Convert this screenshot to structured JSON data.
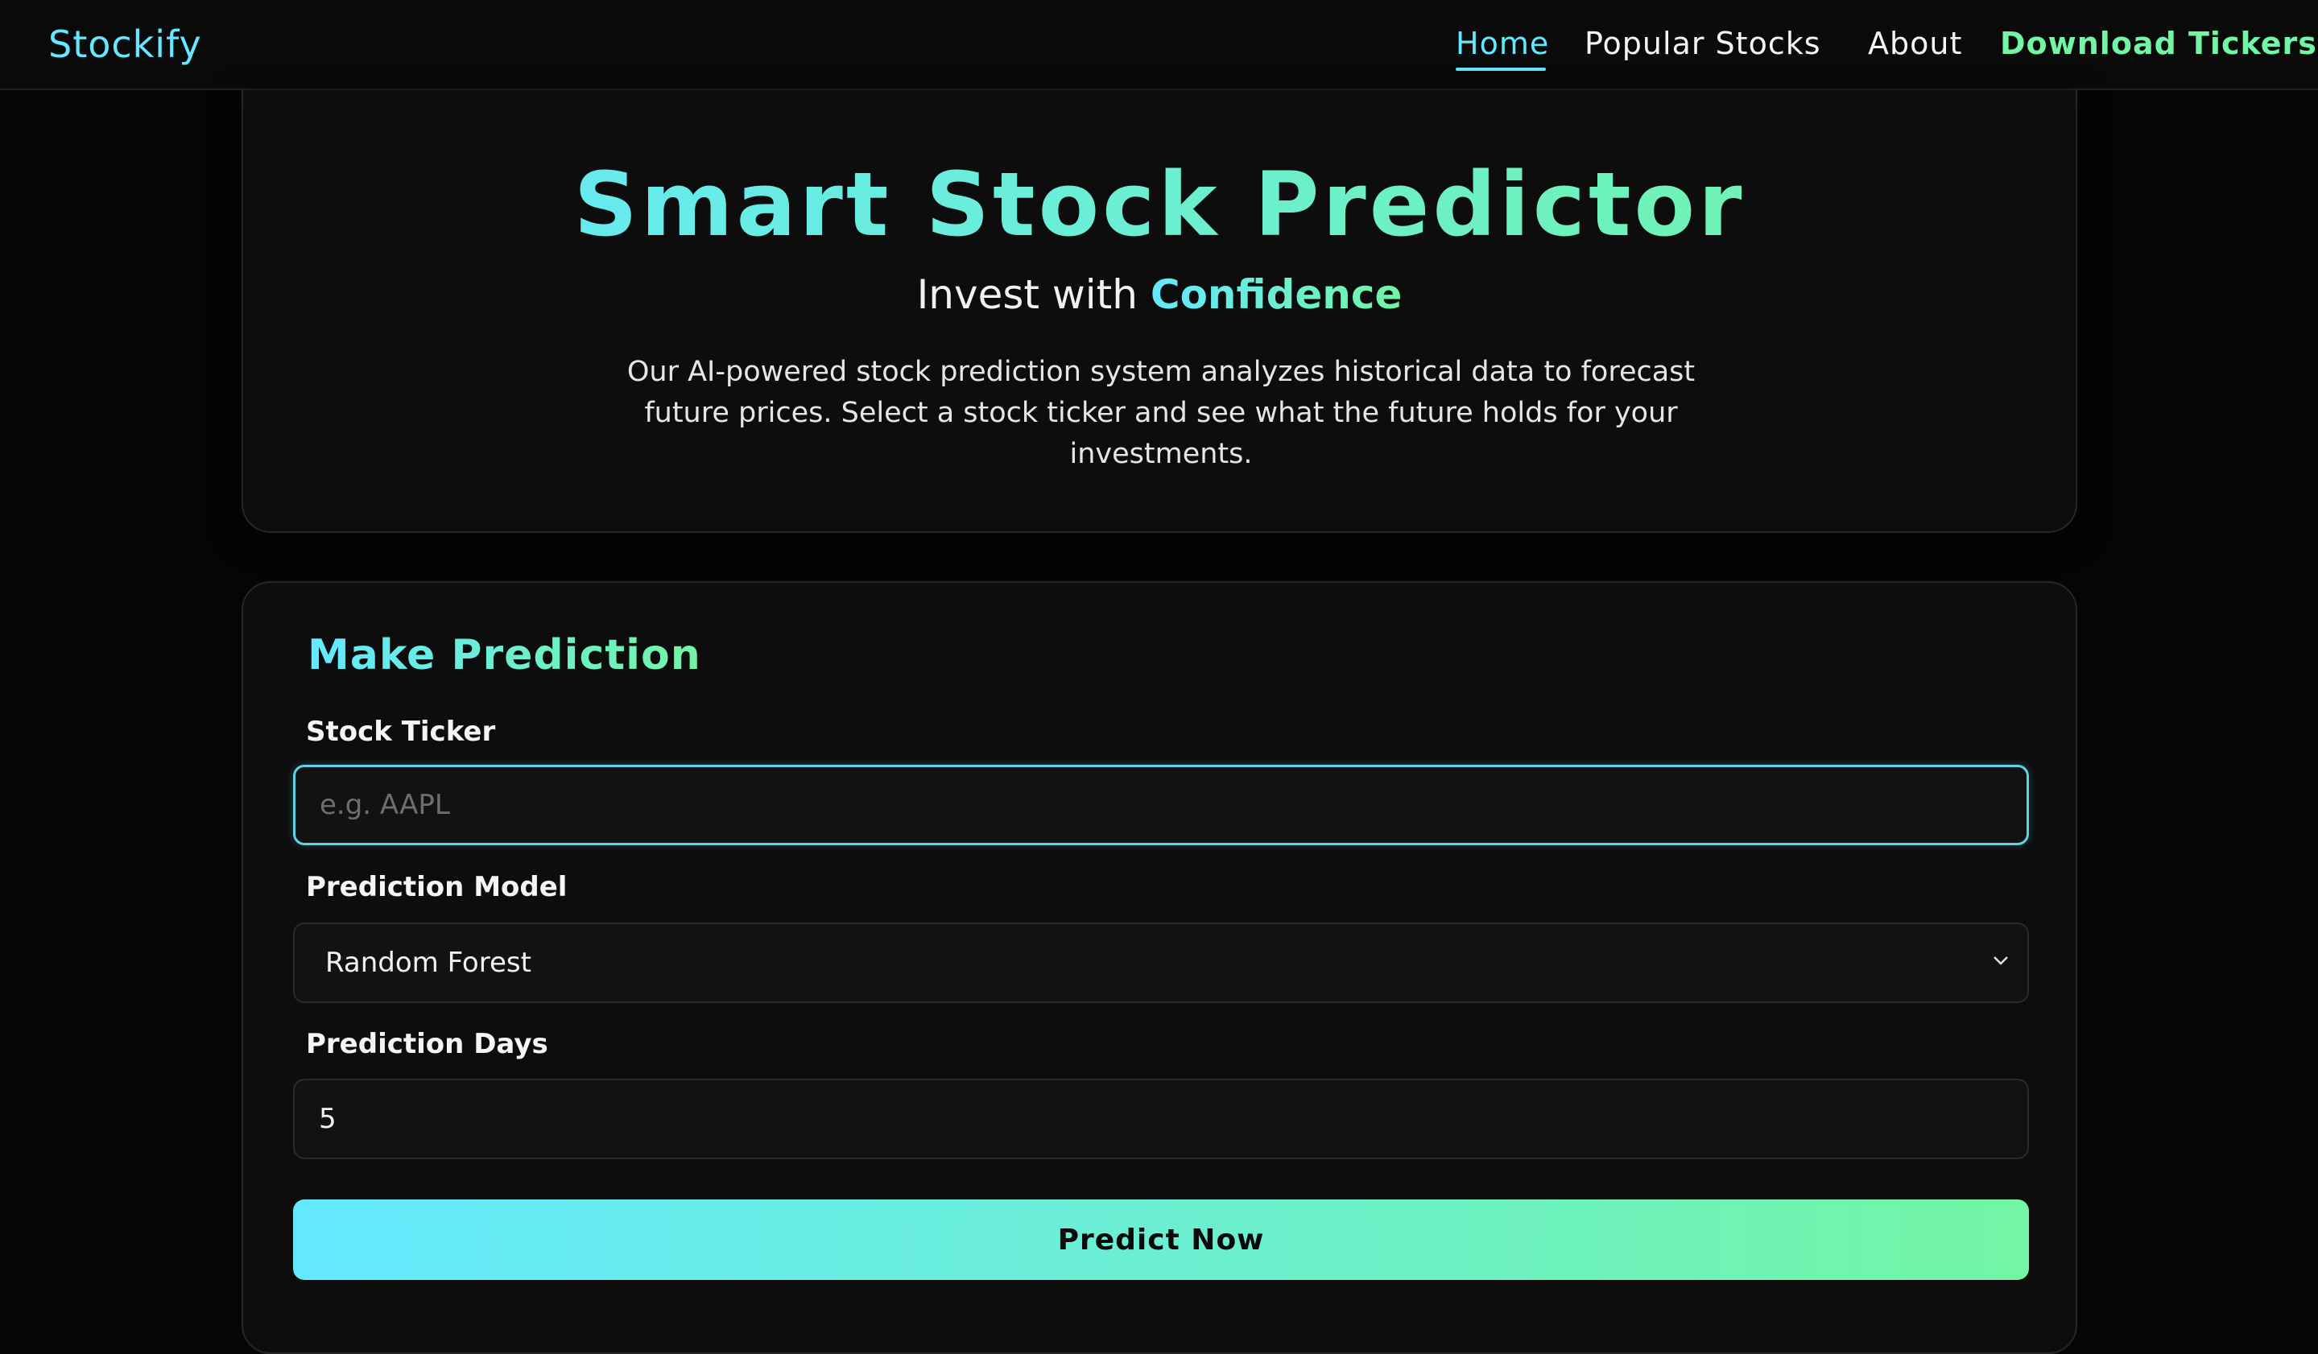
{
  "navbar": {
    "brand": "Stockify",
    "links": {
      "home": "Home",
      "popular": "Popular Stocks",
      "about": "About",
      "download": "Download Tickers"
    },
    "active": "home"
  },
  "hero": {
    "title": "Smart Stock Predictor",
    "subtitle_prefix": "Invest with ",
    "subtitle_accent": "Confidence",
    "description": "Our AI-powered stock prediction system analyzes historical data to forecast future prices. Select a stock ticker and see what the future holds for your investments."
  },
  "form": {
    "title": "Make Prediction",
    "ticker": {
      "label": "Stock Ticker",
      "placeholder": "e.g. AAPL",
      "value": ""
    },
    "model": {
      "label": "Prediction Model",
      "selected": "Random Forest"
    },
    "days": {
      "label": "Prediction Days",
      "value": "5"
    },
    "submit_label": "Predict Now"
  },
  "colors": {
    "accent_cyan": "#64e8ff",
    "accent_green": "#72f5a4",
    "background": "#050505",
    "card": "#0d0d0d"
  },
  "icons": {
    "select_chevron": "chevron-down-icon"
  }
}
